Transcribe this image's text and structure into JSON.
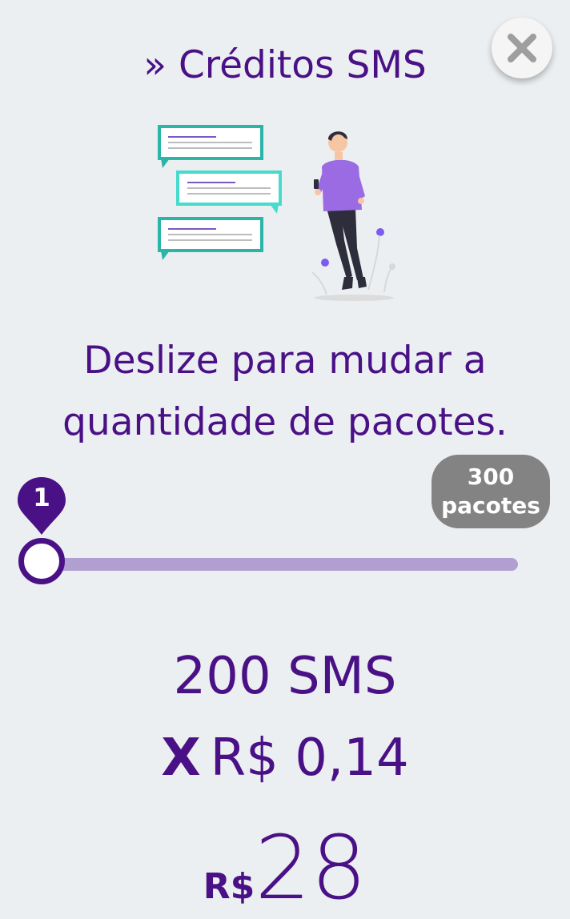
{
  "modal": {
    "title": "» Créditos SMS",
    "close_icon": "close-icon"
  },
  "instruction": {
    "line1": "Deslize para mudar a",
    "line2": "quantidade de pacotes."
  },
  "slider": {
    "current_value": "1",
    "min": 1,
    "max": 300,
    "value": 1,
    "max_label_number": "300",
    "max_label_unit": "pacotes"
  },
  "summary": {
    "sms_count": "200 SMS",
    "multiplier": "X",
    "unit_price": "R$ 0,14",
    "total_currency": "R$",
    "total_amount": "28"
  },
  "colors": {
    "primary": "#4A1187",
    "track": "#B29FD1",
    "badge": "#838383",
    "background": "#ECEFF1",
    "accent_teal": "#2BC4B6",
    "accent_purple": "#9B6BE3"
  }
}
